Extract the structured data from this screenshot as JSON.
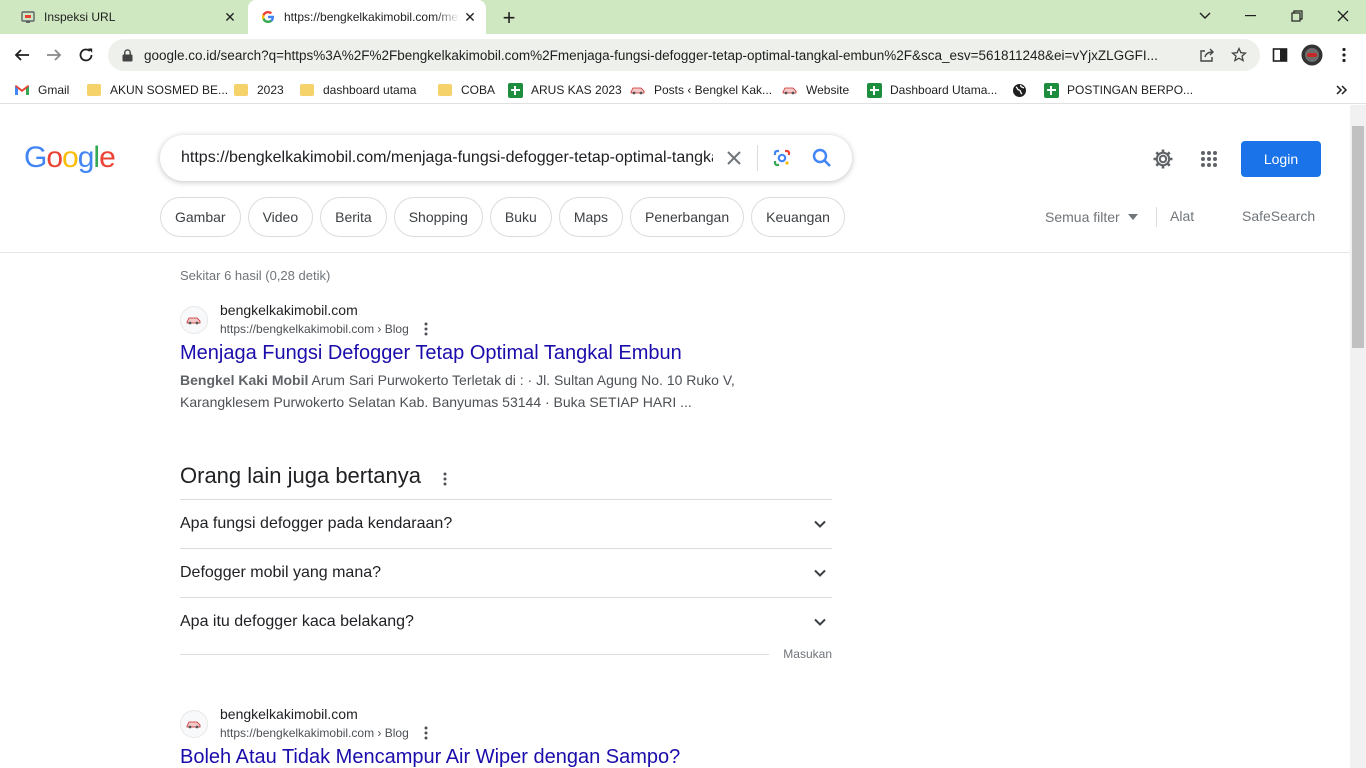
{
  "browser": {
    "tabs": [
      {
        "title": "Inspeksi URL",
        "favicon": "search-console-icon",
        "active": false
      },
      {
        "title": "https://bengkelkakimobil.com/menjaga-fungsi-defogger",
        "favicon": "google-icon",
        "active": true
      }
    ],
    "address": "google.co.id/search?q=https%3A%2F%2Fbengkelkakimobil.com%2Fmenjaga-fungsi-defogger-tetap-optimal-tangkal-embun%2F&sca_esv=561811248&ei=vYjxZLGGFI...",
    "bookmarks": [
      {
        "label": "Gmail",
        "icon": "gmail-icon"
      },
      {
        "label": "AKUN SOSMED BE...",
        "icon": "folder-icon"
      },
      {
        "label": "2023",
        "icon": "folder-icon"
      },
      {
        "label": "dashboard utama",
        "icon": "folder-icon"
      },
      {
        "label": "COBA",
        "icon": "folder-icon"
      },
      {
        "label": "ARUS KAS 2023",
        "icon": "sheets-icon"
      },
      {
        "label": "Posts ‹ Bengkel Kak...",
        "icon": "car-icon"
      },
      {
        "label": "Website",
        "icon": "car-icon"
      },
      {
        "label": "Dashboard Utama...",
        "icon": "sheets-icon"
      },
      {
        "label": "",
        "icon": "globe-icon"
      },
      {
        "label": "POSTINGAN BERPO...",
        "icon": "sheets-icon"
      }
    ]
  },
  "google": {
    "logo": "Google",
    "query": "https://bengkelkakimobil.com/menjaga-fungsi-defogger-tetap-optimal-tangkal-embun/",
    "login": "Login",
    "chips": [
      "Gambar",
      "Video",
      "Berita",
      "Shopping",
      "Buku",
      "Maps",
      "Penerbangan",
      "Keuangan"
    ],
    "all_filters": "Semua filter",
    "tools": "Alat",
    "safesearch": "SafeSearch",
    "stats": "Sekitar 6 hasil (0,28 detik)"
  },
  "results": [
    {
      "site": "bengkelkakimobil.com",
      "url": "https://bengkelkakimobil.com › Blog",
      "title": "Menjaga Fungsi Defogger Tetap Optimal Tangkal Embun",
      "snippet_bold": "Bengkel Kaki Mobil",
      "snippet_line1": " Arum Sari Purwokerto Terletak di : · Jl. Sultan Agung No. 10 Ruko V,",
      "snippet_line2": "Karangklesem Purwokerto Selatan Kab. Banyumas 53144 · Buka SETIAP HARI ..."
    },
    {
      "site": "bengkelkakimobil.com",
      "url": "https://bengkelkakimobil.com › Blog",
      "title": "Boleh Atau Tidak Mencampur Air Wiper dengan Sampo?"
    }
  ],
  "paa": {
    "heading": "Orang lain juga bertanya",
    "questions": [
      "Apa fungsi defogger pada kendaraan?",
      "Defogger mobil yang mana?",
      "Apa itu defogger kaca belakang?"
    ],
    "feedback": "Masukan"
  },
  "colors": {
    "link": "#1a0dab",
    "primary": "#1a73e8",
    "tabstrip": "#cfe8c1"
  }
}
